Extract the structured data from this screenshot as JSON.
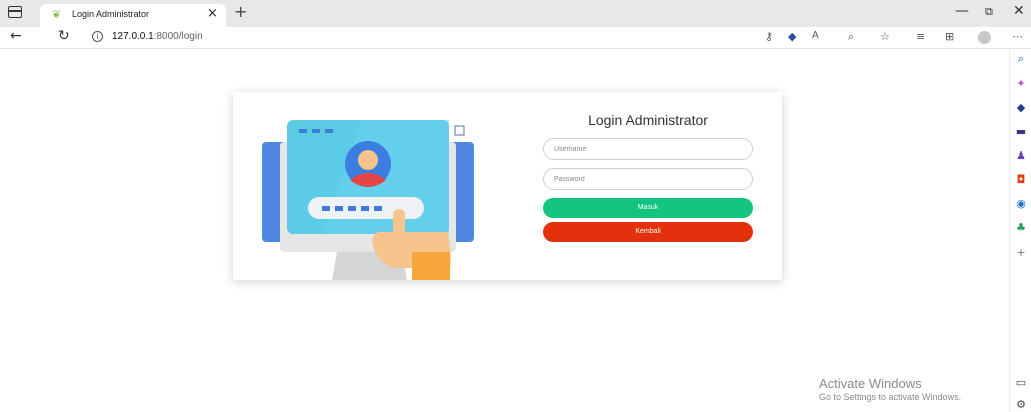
{
  "browser": {
    "tab_title": "Login Administrator",
    "tab_close": "×",
    "new_tab": "+",
    "url_host": "127.0.0.1",
    "url_path": ":8000/login",
    "window_controls": {
      "minimize": "—",
      "maximize": "⧉",
      "close": "✕"
    }
  },
  "login": {
    "title": "Login Administrator",
    "username_placeholder": "Username",
    "password_placeholder": "Password",
    "submit_label": "Masuk",
    "back_label": "Kembali"
  },
  "colors": {
    "submit": "#12c47f",
    "back": "#e4310d",
    "illustration_screen": "#5ccbe6",
    "illustration_frame": "#4f86e0",
    "avatar_bg": "#3d7de0",
    "avatar_face": "#f7c48c",
    "avatar_shirt": "#e64545"
  },
  "icons": {
    "favicon": "leaf-icon",
    "back": "arrow-left-icon",
    "reload": "reload-icon",
    "info": "info-icon",
    "toolbar": [
      "key-icon",
      "tag-icon",
      "read-aloud-icon",
      "zoom-icon",
      "favorite-add-icon",
      "favorites-icon",
      "collections-icon",
      "profile-icon",
      "more-icon"
    ],
    "sidebar": [
      "search-icon",
      "sparkle-icon",
      "shopping-icon",
      "briefcase-icon",
      "games-icon",
      "office-icon",
      "outlook-icon",
      "tree-icon",
      "add-icon"
    ]
  },
  "watermark": {
    "title": "Activate Windows",
    "subtitle": "Go to Settings to activate Windows."
  }
}
